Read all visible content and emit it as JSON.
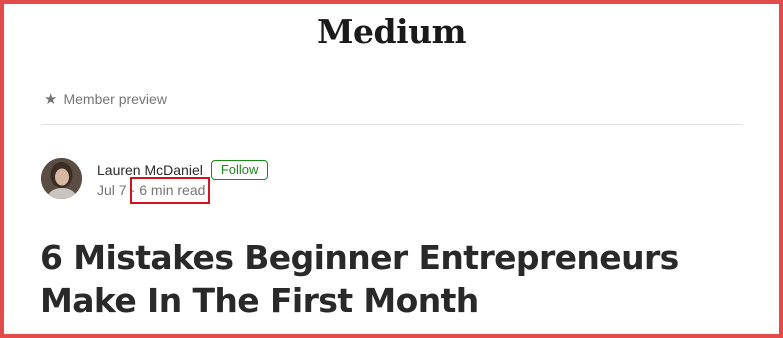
{
  "header": {
    "logo_text": "Medium"
  },
  "preview": {
    "icon": "star-icon",
    "label": "Member preview"
  },
  "author": {
    "name": "Lauren McDaniel",
    "follow_label": "Follow",
    "date": "Jul 7",
    "separator": "·",
    "read_time": "6 min read"
  },
  "article": {
    "title": "6 Mistakes Beginner Entrepreneurs Make In The First Month"
  },
  "colors": {
    "accent_green": "#1a8917",
    "highlight_red": "#d6121e",
    "frame_red": "#e34b4b"
  }
}
